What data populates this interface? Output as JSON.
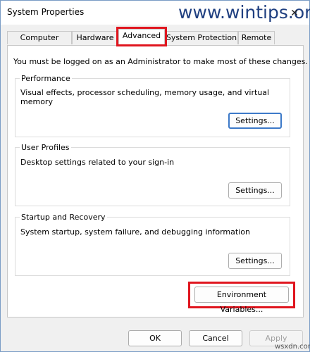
{
  "window": {
    "title": "System Properties",
    "watermark": "www.wintips.org",
    "close_glyph": "✕"
  },
  "tabs": [
    {
      "label": "Computer Name",
      "active": false
    },
    {
      "label": "Hardware",
      "active": false
    },
    {
      "label": "Advanced",
      "active": true
    },
    {
      "label": "System Protection",
      "active": false
    },
    {
      "label": "Remote",
      "active": false
    }
  ],
  "notice": "You must be logged on as an Administrator to make most of these changes.",
  "performance": {
    "label": "Performance",
    "description": "Visual effects, processor scheduling, memory usage, and virtual memory",
    "button": "Settings..."
  },
  "user_profiles": {
    "label": "User Profiles",
    "description": "Desktop settings related to your sign-in",
    "button": "Settings..."
  },
  "startup_recovery": {
    "label": "Startup and Recovery",
    "description": "System startup, system failure, and debugging information",
    "button": "Settings..."
  },
  "environment_button": "Environment Variables...",
  "footer": {
    "ok": "OK",
    "cancel": "Cancel",
    "apply": "Apply"
  },
  "footer_watermark": "wsxdn.com",
  "highlight_color": "#e0161f",
  "icons": {
    "close": "close-icon"
  }
}
